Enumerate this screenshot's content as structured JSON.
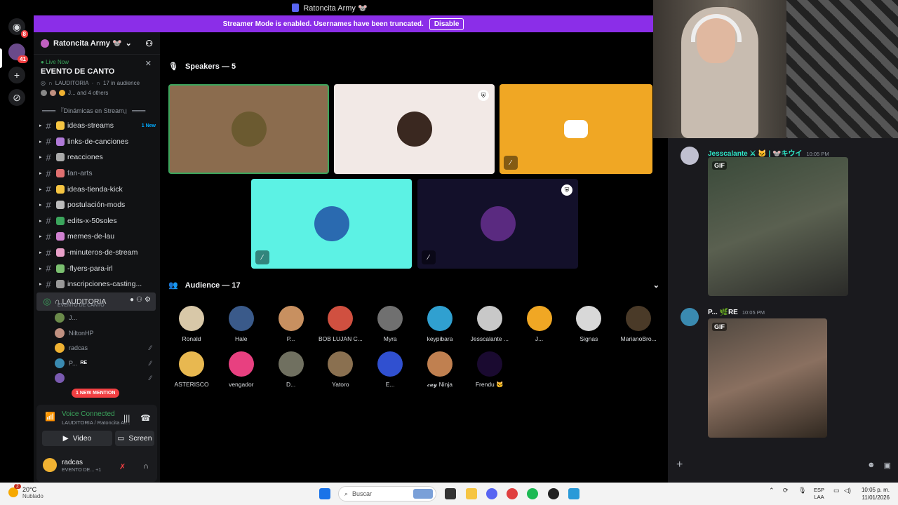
{
  "window_title": "Ratoncita Army 🐭",
  "rail": {
    "dm_badge": "8",
    "server_badge": "41"
  },
  "banner": {
    "text": "Streamer Mode is enabled. Usernames have been truncated.",
    "button": "Disable"
  },
  "server": {
    "name": "Ratoncita Army 🐭"
  },
  "live": {
    "label": "Live Now",
    "event": "EVENTO DE CANTO",
    "stage": "LAUDITORIA",
    "audience": "17 in audience",
    "others": "J... and 4 others"
  },
  "category": "═══ 『Dinámicas en Stream』 ═══",
  "channels": [
    {
      "label": "ideas-streams",
      "emoji_color": "#f6c542",
      "new": "1 New"
    },
    {
      "label": "links-de-canciones",
      "emoji_color": "#b07ad8",
      "new": ""
    },
    {
      "label": "reacciones",
      "emoji_color": "#aaaaaa",
      "new": ""
    },
    {
      "label": "fan-arts",
      "emoji_color": "#e07070",
      "new": ""
    },
    {
      "label": "ideas-tienda-kick",
      "emoji_color": "#f6c542",
      "new": ""
    },
    {
      "label": "postulación-mods",
      "emoji_color": "#bbbbbb",
      "new": ""
    },
    {
      "label": "edits-x-50soles",
      "emoji_color": "#3ba55c",
      "new": ""
    },
    {
      "label": "memes-de-lau",
      "emoji_color": "#d080d0",
      "new": ""
    },
    {
      "label": "-minuteros-de-stream",
      "emoji_color": "#e8a0c8",
      "new": ""
    },
    {
      "label": "-flyers-para-irl",
      "emoji_color": "#7bc070",
      "new": ""
    },
    {
      "label": "inscripciones-casting...",
      "emoji_color": "#999999",
      "new": ""
    }
  ],
  "voice_channel": {
    "name": "LAUDITORIA",
    "sub": "EVENTO DE CANTO"
  },
  "voice_users": [
    {
      "name": "J...",
      "color": "#6a8a4a",
      "muted": false,
      "tag": ""
    },
    {
      "name": "NiltonHP",
      "color": "#c09080",
      "muted": false,
      "tag": ""
    },
    {
      "name": "radcas",
      "color": "#f0b232",
      "muted": true,
      "tag": ""
    },
    {
      "name": "P...",
      "color": "#3a8ab0",
      "muted": true,
      "tag": "RE"
    },
    {
      "name": "",
      "color": "#7a5ab0",
      "muted": true,
      "tag": ""
    }
  ],
  "mention": "1 NEW MENTION",
  "voice_panel": {
    "status": "Voice Connected",
    "sub": "LAUDITORIA / Ratoncita Ar...",
    "video": "Video",
    "screen": "Screen"
  },
  "user": {
    "name": "radcas",
    "sub": "EVENTO DE...",
    "extra": "+1"
  },
  "speakers": {
    "header": "Speakers — 5",
    "tiles": [
      {
        "bg": "#8b6c4e",
        "avatar": "#6b5a30",
        "shield": false,
        "muted": false
      },
      {
        "bg": "#f2e9e6",
        "avatar": "#3a2820",
        "shield": true,
        "muted": false
      },
      {
        "bg": "#f0a724",
        "avatar": "#f0a724",
        "shield": false,
        "muted": true
      },
      {
        "bg": "#5cf2e4",
        "avatar": "#2a6ab0",
        "shield": false,
        "muted": true
      },
      {
        "bg": "#13102a",
        "avatar": "#5a2a80",
        "shield": true,
        "muted": true
      }
    ]
  },
  "audience": {
    "header": "Audience — 17",
    "members": [
      {
        "name": "Ronald",
        "color": "#d8c8a8"
      },
      {
        "name": "Hale",
        "color": "#3a5a8a"
      },
      {
        "name": "P...",
        "color": "#c89060"
      },
      {
        "name": "BOB LUJAN C...",
        "color": "#d05040"
      },
      {
        "name": "Myra",
        "color": "#707070"
      },
      {
        "name": "keypibara",
        "color": "#30a0d0"
      },
      {
        "name": "Jesscalante ...",
        "color": "#c8c8c8"
      },
      {
        "name": "J...",
        "color": "#f0a724"
      },
      {
        "name": "Signas",
        "color": "#d8d8d8"
      },
      {
        "name": "MarianoBro...",
        "color": "#4a3a28"
      },
      {
        "name": "ASTERISCO",
        "color": "#e8b850"
      },
      {
        "name": "vengador",
        "color": "#e84080"
      },
      {
        "name": "D...",
        "color": "#707060"
      },
      {
        "name": "Yatoro",
        "color": "#8a7050"
      },
      {
        "name": "E...",
        "color": "#3050d0"
      },
      {
        "name": "𝓬𝓾𝔂 Ninja",
        "color": "#c08050"
      },
      {
        "name": "Frendu 🐱",
        "color": "#1a0a30"
      }
    ]
  },
  "chat": {
    "messages": [
      {
        "author": "Jesscalante ⚔ 🐱 | 🐭キウイ",
        "time": "10:05 PM",
        "color": "#2ee8c8",
        "avatar": "#c0c0d0",
        "gif": "GIF"
      },
      {
        "author": "P... 🌿RE",
        "time": "10:05 PM",
        "color": "#f2f3f5",
        "avatar": "#3a8ab0",
        "gif": "GIF"
      }
    ]
  },
  "taskbar": {
    "weather_temp": "20°C",
    "weather_desc": "Nublado",
    "weather_badge": "2",
    "search": "Buscar",
    "lang": "ESP",
    "lang_sub": "LAA",
    "time": "10:05 p. m.",
    "date": "11/01/2026"
  }
}
